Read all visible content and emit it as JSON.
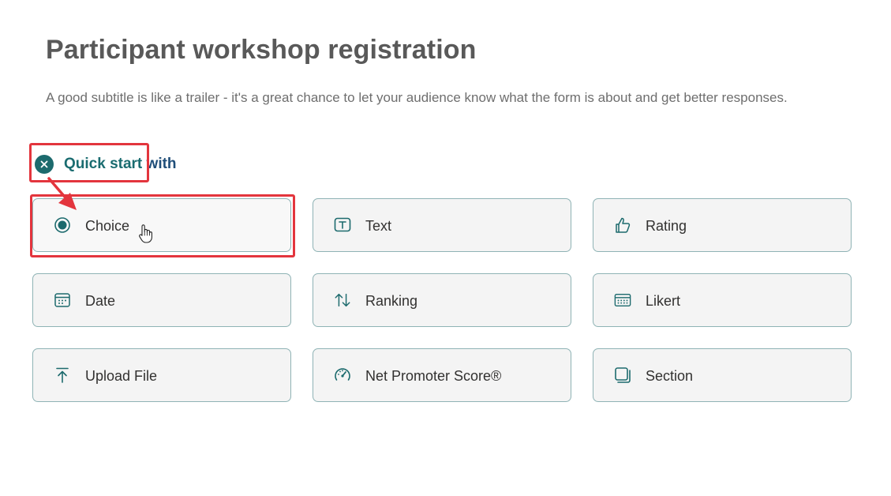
{
  "form": {
    "title": "Participant workshop registration",
    "subtitle": "A good subtitle is like a trailer - it's a great chance to let your audience know what the form is about and get better responses."
  },
  "quick_start": {
    "label_main": "Quick start ",
    "label_tail": "with",
    "close_icon": "close-icon"
  },
  "question_types": [
    {
      "label": "Choice",
      "icon": "radio-icon"
    },
    {
      "label": "Text",
      "icon": "text-icon"
    },
    {
      "label": "Rating",
      "icon": "thumbs-up-icon"
    },
    {
      "label": "Date",
      "icon": "calendar-icon"
    },
    {
      "label": "Ranking",
      "icon": "ranking-icon"
    },
    {
      "label": "Likert",
      "icon": "likert-icon"
    },
    {
      "label": "Upload File",
      "icon": "upload-icon"
    },
    {
      "label": "Net Promoter Score®",
      "icon": "gauge-icon"
    },
    {
      "label": "Section",
      "icon": "section-icon"
    }
  ],
  "colors": {
    "accent": "#1c6a6d",
    "card_border": "#8fb3b5",
    "card_bg": "#f4f4f4",
    "annotation": "#e3353d"
  }
}
